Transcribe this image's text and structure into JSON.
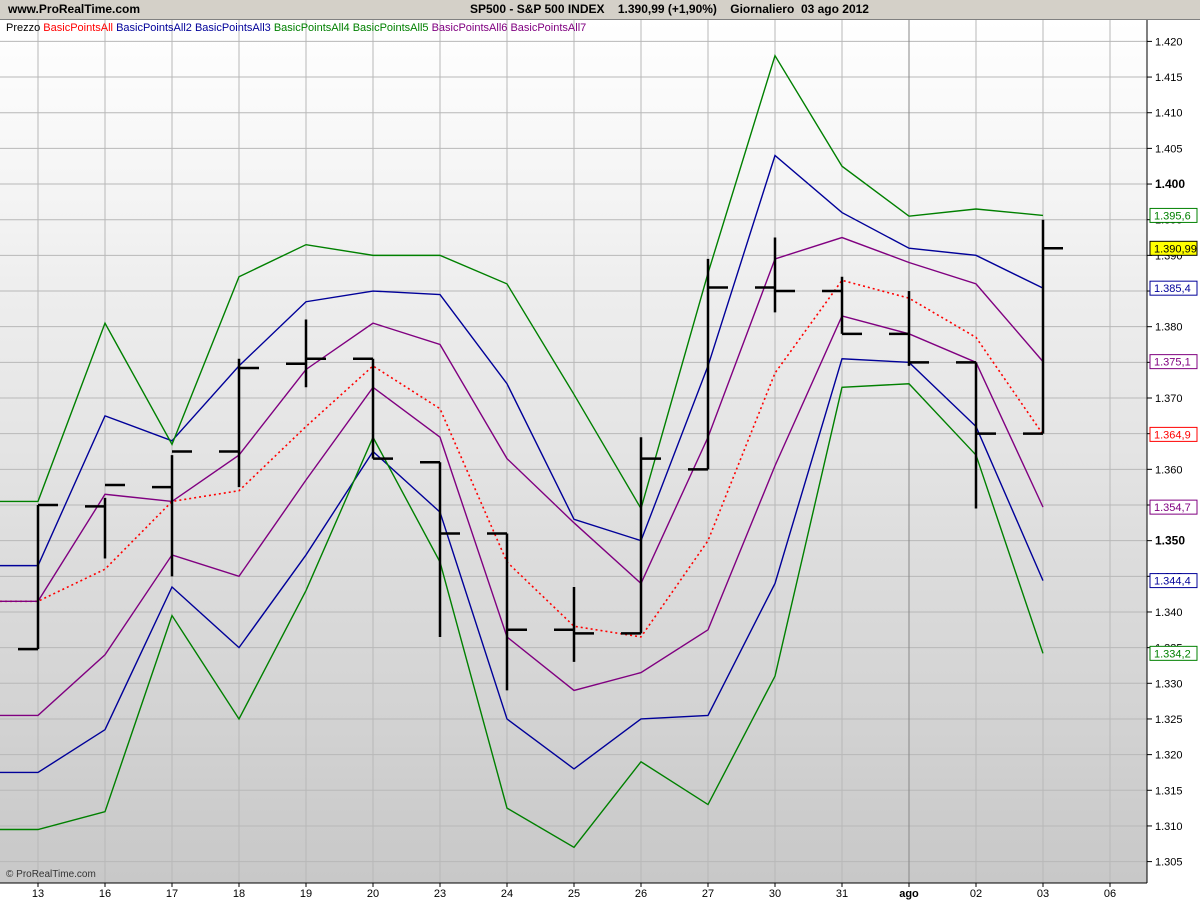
{
  "header": {
    "site": "www.ProRealTime.com",
    "title": "SP500 - S&P 500 INDEX    1.390,99 (+1,90%)    Giornaliero  03 ago 2012"
  },
  "watermark": "© ProRealTime.com",
  "colors": {
    "price": "#000000",
    "pivot": "#ff0000",
    "l1": "#000099",
    "l2": "#008000",
    "l3": "#800080",
    "highlight_bg": "#ffff00"
  },
  "chart_data": {
    "type": "line",
    "title": "SP500 - S&P 500 INDEX",
    "xlabel": "",
    "ylabel": "",
    "categories": [
      "13",
      "16",
      "17",
      "18",
      "19",
      "20",
      "23",
      "24",
      "25",
      "26",
      "27",
      "30",
      "31",
      "ago",
      "02",
      "03"
    ],
    "x_axis_labels": [
      "13",
      "16",
      "17",
      "18",
      "19",
      "20",
      "23",
      "24",
      "25",
      "26",
      "27",
      "30",
      "31",
      "ago",
      "02",
      "03",
      "06"
    ],
    "ylim": [
      1302,
      1423
    ],
    "y_ticks": [
      1305,
      1310,
      1315,
      1320,
      1325,
      1330,
      1335,
      1340,
      1345,
      1350,
      1355,
      1360,
      1365,
      1370,
      1375,
      1380,
      1385,
      1390,
      1395,
      1400,
      1405,
      1410,
      1415,
      1420
    ],
    "y_tick_labels": [
      "1.305",
      "1.310",
      "1.315",
      "1.320",
      "1.325",
      "1.330",
      "1.335",
      "1.340",
      "1.345",
      "1.350",
      "1.355",
      "1.360",
      "1.365",
      "1.370",
      "1.375",
      "1.380",
      "1.385",
      "1.390",
      "1.395",
      "1.400",
      "1.405",
      "1.410",
      "1.415",
      "1.420"
    ],
    "y_bold_ticks": [
      "1.350",
      "1.400"
    ],
    "grid": true,
    "legend": "top-left",
    "legend_entries": [
      {
        "name": "Prezzo",
        "color": "#000000"
      },
      {
        "name": "BasicPointsAll",
        "color": "#ff0000"
      },
      {
        "name": "BasicPointsAll2",
        "color": "#000099"
      },
      {
        "name": "BasicPointsAll3",
        "color": "#000099"
      },
      {
        "name": "BasicPointsAll4",
        "color": "#008000"
      },
      {
        "name": "BasicPointsAll5",
        "color": "#008000"
      },
      {
        "name": "BasicPointsAll6",
        "color": "#800080"
      },
      {
        "name": "BasicPointsAll7",
        "color": "#800080"
      }
    ],
    "ohlc": [
      {
        "open": 1334.8,
        "high": 1355.0,
        "low": 1334.8,
        "close": 1355.0
      },
      {
        "open": 1354.8,
        "high": 1356.0,
        "low": 1347.5,
        "close": 1357.8
      },
      {
        "open": 1357.5,
        "high": 1362.0,
        "low": 1345.0,
        "close": 1362.5
      },
      {
        "open": 1362.5,
        "high": 1375.5,
        "low": 1357.5,
        "close": 1374.2
      },
      {
        "open": 1374.8,
        "high": 1381.0,
        "low": 1371.5,
        "close": 1375.5
      },
      {
        "open": 1375.5,
        "high": 1375.5,
        "low": 1361.5,
        "close": 1361.5
      },
      {
        "open": 1361.0,
        "high": 1361.0,
        "low": 1336.5,
        "close": 1351.0
      },
      {
        "open": 1351.0,
        "high": 1351.0,
        "low": 1329.0,
        "close": 1337.5
      },
      {
        "open": 1337.5,
        "high": 1343.5,
        "low": 1333.0,
        "close": 1337.0
      },
      {
        "open": 1337.0,
        "high": 1364.5,
        "low": 1337.0,
        "close": 1361.5
      },
      {
        "open": 1360.0,
        "high": 1389.5,
        "low": 1360.0,
        "close": 1385.5
      },
      {
        "open": 1385.5,
        "high": 1392.5,
        "low": 1382.0,
        "close": 1385.0
      },
      {
        "open": 1385.0,
        "high": 1387.0,
        "low": 1379.0,
        "close": 1379.0
      },
      {
        "open": 1379.0,
        "high": 1385.0,
        "low": 1374.5,
        "close": 1375.0
      },
      {
        "open": 1375.0,
        "high": 1375.0,
        "low": 1354.5,
        "close": 1365.0
      },
      {
        "open": 1365.0,
        "high": 1395.0,
        "low": 1365.0,
        "close": 1390.99
      }
    ],
    "series": [
      {
        "name": "BasicPointsAll",
        "color": "#ff0000",
        "dashed": true,
        "values": [
          1341.5,
          1346.0,
          1355.5,
          1357.0,
          1366.0,
          1374.5,
          1368.5,
          1347.0,
          1338.0,
          1336.5,
          1350.0,
          1373.5,
          1386.5,
          1384.0,
          1378.5,
          1364.9
        ]
      },
      {
        "name": "BasicPointsAll2",
        "color": "#000099",
        "values": [
          1346.5,
          1367.5,
          1364.0,
          1374.5,
          1383.5,
          1385.0,
          1384.5,
          1372.0,
          1353.0,
          1350.0,
          1374.5,
          1404.0,
          1396.0,
          1391.0,
          1390.0,
          1385.4
        ]
      },
      {
        "name": "BasicPointsAll3",
        "color": "#000099",
        "values": [
          1317.5,
          1323.5,
          1343.5,
          1335.0,
          1348.0,
          1362.5,
          1354.0,
          1325.0,
          1318.0,
          1325.0,
          1325.5,
          1344.0,
          1375.5,
          1375.0,
          1366.0,
          1344.4
        ]
      },
      {
        "name": "BasicPointsAll4",
        "color": "#008000",
        "values": [
          1355.5,
          1380.5,
          1363.5,
          1387.0,
          1391.5,
          1390.0,
          1390.0,
          1386.0,
          1370.5,
          1354.5,
          1387.5,
          1418.0,
          1402.5,
          1395.5,
          1396.5,
          1395.6
        ]
      },
      {
        "name": "BasicPointsAll5",
        "color": "#008000",
        "values": [
          1309.5,
          1312.0,
          1339.5,
          1325.0,
          1343.0,
          1364.5,
          1347.0,
          1312.5,
          1307.0,
          1319.0,
          1313.0,
          1331.0,
          1371.5,
          1372.0,
          1362.0,
          1334.2
        ]
      },
      {
        "name": "BasicPointsAll6",
        "color": "#800080",
        "values": [
          1341.5,
          1356.5,
          1355.5,
          1362.0,
          1374.0,
          1380.5,
          1377.5,
          1361.5,
          1352.5,
          1344.0,
          1364.5,
          1389.5,
          1392.5,
          1389.0,
          1386.0,
          1375.1
        ]
      },
      {
        "name": "BasicPointsAll7",
        "color": "#800080",
        "values": [
          1325.5,
          1334.0,
          1348.0,
          1345.0,
          1358.5,
          1371.5,
          1364.5,
          1336.5,
          1329.0,
          1331.5,
          1337.5,
          1360.5,
          1381.5,
          1379.0,
          1375.0,
          1354.7
        ]
      }
    ],
    "last_value_labels": [
      {
        "text": "1.395,6",
        "color": "#008000",
        "value": 1395.6
      },
      {
        "text": "1.390,99",
        "color": "#000000",
        "value": 1390.99,
        "highlight": true
      },
      {
        "text": "1.385,4",
        "color": "#000099",
        "value": 1385.4
      },
      {
        "text": "1.375,1",
        "color": "#800080",
        "value": 1375.1
      },
      {
        "text": "1.364,9",
        "color": "#ff0000",
        "value": 1364.9
      },
      {
        "text": "1.354,7",
        "color": "#800080",
        "value": 1354.7
      },
      {
        "text": "1.344,4",
        "color": "#000099",
        "value": 1344.4
      },
      {
        "text": "1.334,2",
        "color": "#008000",
        "value": 1334.2
      }
    ]
  }
}
